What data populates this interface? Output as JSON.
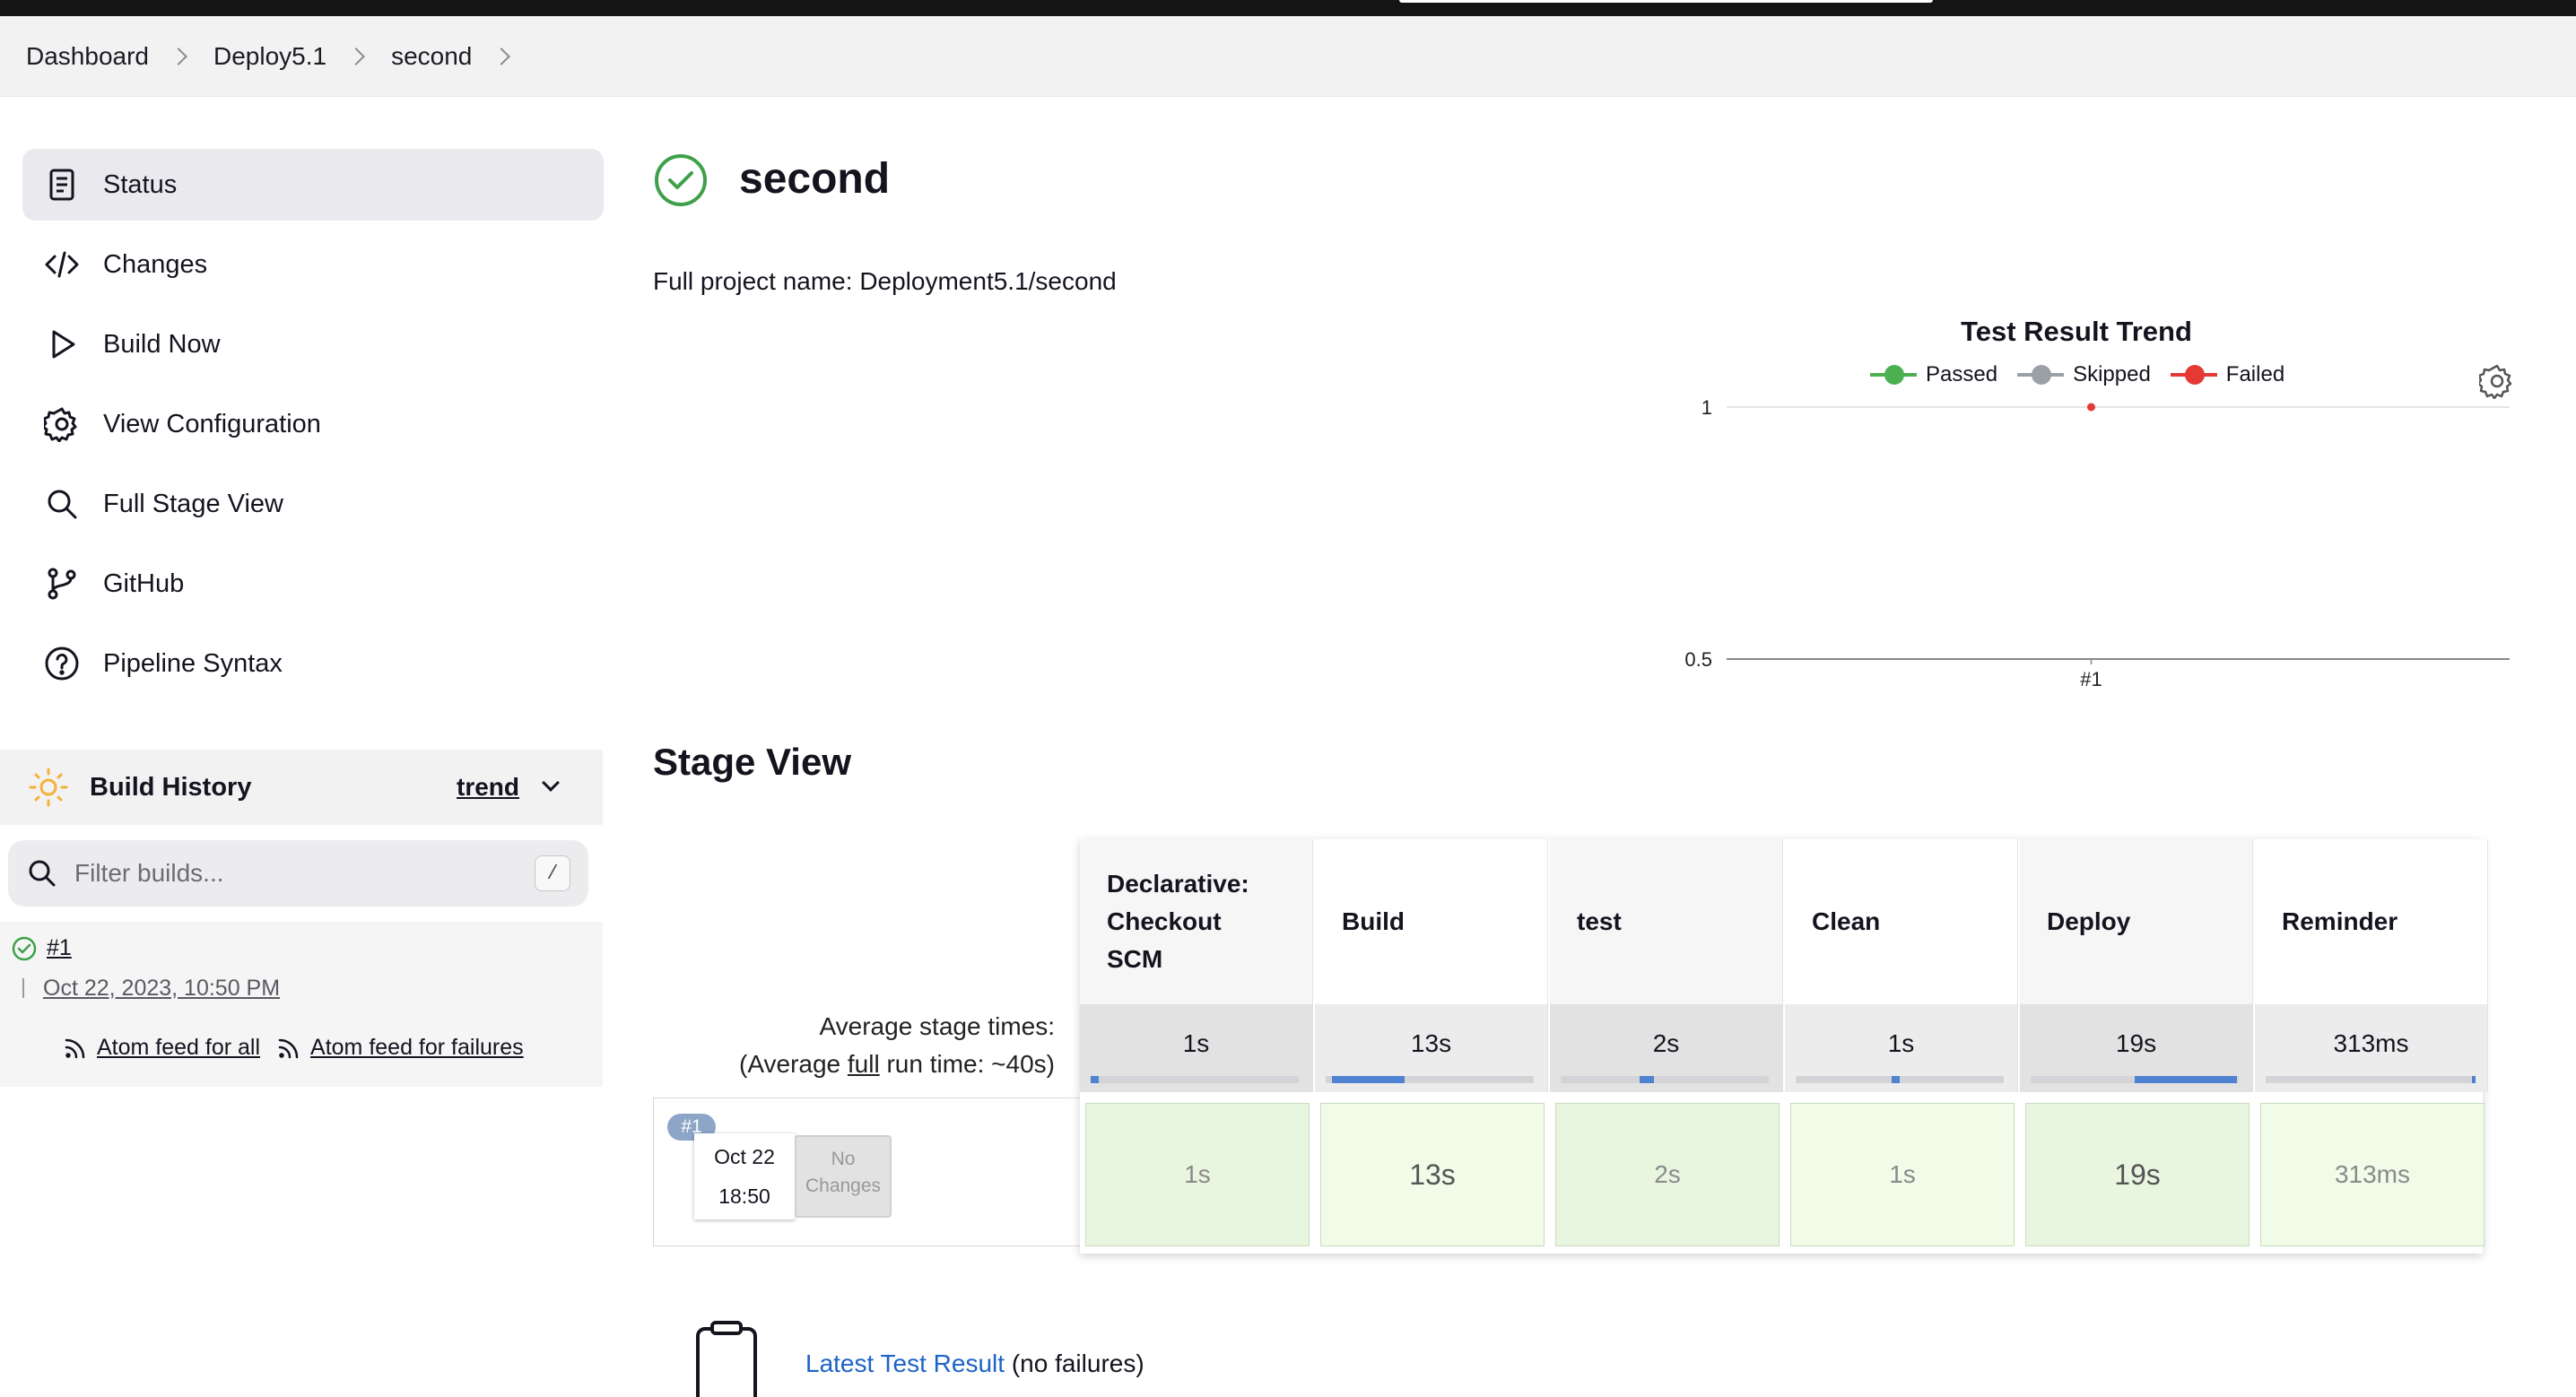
{
  "breadcrumb": [
    "Dashboard",
    "Deploy5.1",
    "second"
  ],
  "sidebar": {
    "items": [
      {
        "label": "Status",
        "icon": "status-document-icon"
      },
      {
        "label": "Changes",
        "icon": "code-icon"
      },
      {
        "label": "Build Now",
        "icon": "play-icon"
      },
      {
        "label": "View Configuration",
        "icon": "gear-icon"
      },
      {
        "label": "Full Stage View",
        "icon": "search-icon"
      },
      {
        "label": "GitHub",
        "icon": "git-branch-icon"
      },
      {
        "label": "Pipeline Syntax",
        "icon": "help-circle-icon"
      }
    ]
  },
  "build_history": {
    "title": "Build History",
    "trend_label": "trend",
    "filter_placeholder": "Filter builds...",
    "filter_shortcut": "/",
    "builds": [
      {
        "number": "#1",
        "date": "Oct 22, 2023, 10:50 PM",
        "status": "success"
      }
    ],
    "feed_all": "Atom feed for all",
    "feed_failures": "Atom feed for failures"
  },
  "main": {
    "title": "second",
    "full_name": "Full project name: Deployment5.1/second"
  },
  "chart_data": {
    "type": "line",
    "title": "Test Result Trend",
    "x": [
      "#1"
    ],
    "series": [
      {
        "name": "Passed",
        "values": [
          0
        ],
        "color": "#4caf50"
      },
      {
        "name": "Skipped",
        "values": [
          0
        ],
        "color": "#9aa0a6"
      },
      {
        "name": "Failed",
        "values": [
          1
        ],
        "color": "#e53935"
      }
    ],
    "ylim": [
      0.5,
      1
    ],
    "yticks": [
      "1",
      "0.5"
    ],
    "legend": "top"
  },
  "stage_view": {
    "title": "Stage View",
    "avg_label_line1": "Average stage times:",
    "avg_label_line2_pre": "(Average ",
    "avg_label_line2_link": "full",
    "avg_label_line2_post": " run time: ~40s)",
    "stages": [
      {
        "name": "Declarative: Checkout SCM",
        "avg": "1s",
        "run": "1s",
        "bar_start": 0.0,
        "bar_len": 0.04
      },
      {
        "name": "Build",
        "avg": "13s",
        "run": "13s",
        "bar_start": 0.03,
        "bar_len": 0.35
      },
      {
        "name": "test",
        "avg": "2s",
        "run": "2s",
        "bar_start": 0.38,
        "bar_len": 0.07
      },
      {
        "name": "Clean",
        "avg": "1s",
        "run": "1s",
        "bar_start": 0.46,
        "bar_len": 0.04
      },
      {
        "name": "Deploy",
        "avg": "19s",
        "run": "19s",
        "bar_start": 0.5,
        "bar_len": 0.49
      },
      {
        "name": "Reminder",
        "avg": "313ms",
        "run": "313ms",
        "bar_start": 0.99,
        "bar_len": 0.01
      }
    ],
    "run": {
      "badge": "#1",
      "date_line1": "Oct 22",
      "date_line2": "18:50",
      "no_changes_line1": "No",
      "no_changes_line2": "Changes"
    }
  },
  "latest_test": {
    "link": "Latest Test Result",
    "suffix": " (no failures)"
  }
}
